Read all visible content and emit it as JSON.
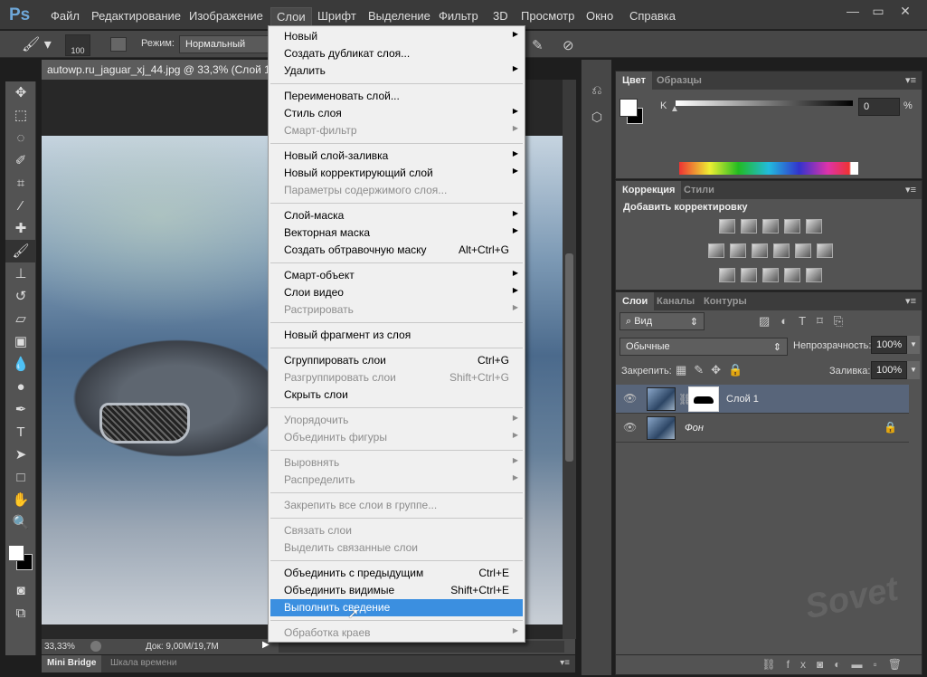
{
  "app": {
    "logo": "Ps"
  },
  "menubar": {
    "items": [
      "Файл",
      "Редактирование",
      "Изображение",
      "Слои",
      "Шрифт",
      "Выделение",
      "Фильтр",
      "3D",
      "Просмотр",
      "Окно",
      "Справка"
    ],
    "active": "Слои"
  },
  "window_controls": {
    "minimize": "—",
    "maximize": "▭",
    "close": "✕"
  },
  "options": {
    "brush_size": "100",
    "mode_label": "Режим:",
    "mode_value": "Нормальный"
  },
  "document": {
    "tab_title": "autowp.ru_jaguar_xj_44.jpg @ 33,3% (Слой 1, ",
    "zoom": "33,33%",
    "doc_size": "Док: 9,00M/19,7M"
  },
  "bottom_tabs": [
    "Mini Bridge",
    "Шкала времени"
  ],
  "color_panel": {
    "tabs": [
      "Цвет",
      "Образцы"
    ],
    "channel": "K",
    "value": "0",
    "unit": "%"
  },
  "adjust_panel": {
    "tabs": [
      "Коррекция",
      "Стили"
    ],
    "heading": "Добавить корректировку"
  },
  "layers_panel": {
    "tabs": [
      "Слои",
      "Каналы",
      "Контуры"
    ],
    "filter": "Вид",
    "blend_mode": "Обычные",
    "opacity_label": "Непрозрачность:",
    "opacity": "100%",
    "lock_label": "Закрепить:",
    "fill_label": "Заливка:",
    "fill": "100%",
    "layers": [
      {
        "name": "Слой 1",
        "selected": true,
        "mask": true
      },
      {
        "name": "Фон",
        "selected": false,
        "locked": true
      }
    ]
  },
  "layers_menu": [
    {
      "label": "Новый",
      "sub": true
    },
    {
      "label": "Создать дубликат слоя..."
    },
    {
      "label": "Удалить",
      "sub": true
    },
    {
      "sep": true
    },
    {
      "label": "Переименовать слой..."
    },
    {
      "label": "Стиль слоя",
      "sub": true
    },
    {
      "label": "Смарт-фильтр",
      "sub": true,
      "disabled": true
    },
    {
      "sep": true
    },
    {
      "label": "Новый слой-заливка",
      "sub": true
    },
    {
      "label": "Новый корректирующий слой",
      "sub": true
    },
    {
      "label": "Параметры содержимого слоя...",
      "disabled": true
    },
    {
      "sep": true
    },
    {
      "label": "Слой-маска",
      "sub": true
    },
    {
      "label": "Векторная маска",
      "sub": true
    },
    {
      "label": "Создать обтравочную маску",
      "shortcut": "Alt+Ctrl+G"
    },
    {
      "sep": true
    },
    {
      "label": "Смарт-объект",
      "sub": true
    },
    {
      "label": "Слои видео",
      "sub": true
    },
    {
      "label": "Растрировать",
      "sub": true,
      "disabled": true
    },
    {
      "sep": true
    },
    {
      "label": "Новый фрагмент из слоя"
    },
    {
      "sep": true
    },
    {
      "label": "Сгруппировать слои",
      "shortcut": "Ctrl+G"
    },
    {
      "label": "Разгруппировать слои",
      "shortcut": "Shift+Ctrl+G",
      "disabled": true
    },
    {
      "label": "Скрыть слои"
    },
    {
      "sep": true
    },
    {
      "label": "Упорядочить",
      "sub": true,
      "disabled": true
    },
    {
      "label": "Объединить фигуры",
      "sub": true,
      "disabled": true
    },
    {
      "sep": true
    },
    {
      "label": "Выровнять",
      "sub": true,
      "disabled": true
    },
    {
      "label": "Распределить",
      "sub": true,
      "disabled": true
    },
    {
      "sep": true
    },
    {
      "label": "Закрепить все слои в группе...",
      "disabled": true
    },
    {
      "sep": true
    },
    {
      "label": "Связать слои",
      "disabled": true
    },
    {
      "label": "Выделить связанные слои",
      "disabled": true
    },
    {
      "sep": true
    },
    {
      "label": "Объединить с предыдущим",
      "shortcut": "Ctrl+E"
    },
    {
      "label": "Объединить видимые",
      "shortcut": "Shift+Ctrl+E"
    },
    {
      "label": "Выполнить сведение",
      "highlighted": true
    },
    {
      "sep": true
    },
    {
      "label": "Обработка краев",
      "sub": true,
      "disabled": true
    }
  ],
  "watermark": "club Sovet",
  "colors": {
    "highlight": "#3b8fe0",
    "menu_bg": "#f0f0f0",
    "panel_bg": "#535353",
    "selected_layer": "#58657a"
  }
}
